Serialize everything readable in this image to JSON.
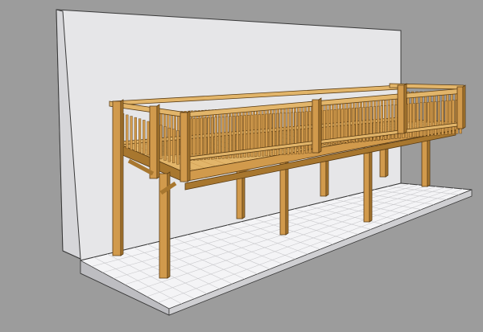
{
  "scene": {
    "description_icon": "3d-model-icon",
    "colors": {
      "background": "#9c9c9c",
      "wall": "#e6e6e8",
      "wall_edge": "#3a3a3a",
      "floor": "#f4f4f6",
      "floor_tile_line": "#c9c9cc",
      "wood_light": "#e2b56a",
      "wood_mid": "#d19a4c",
      "wood_dark": "#a8772f",
      "wood_outline": "#5a3c14"
    },
    "model": {
      "balcony_posts": 9,
      "railing_sections": 3
    }
  }
}
